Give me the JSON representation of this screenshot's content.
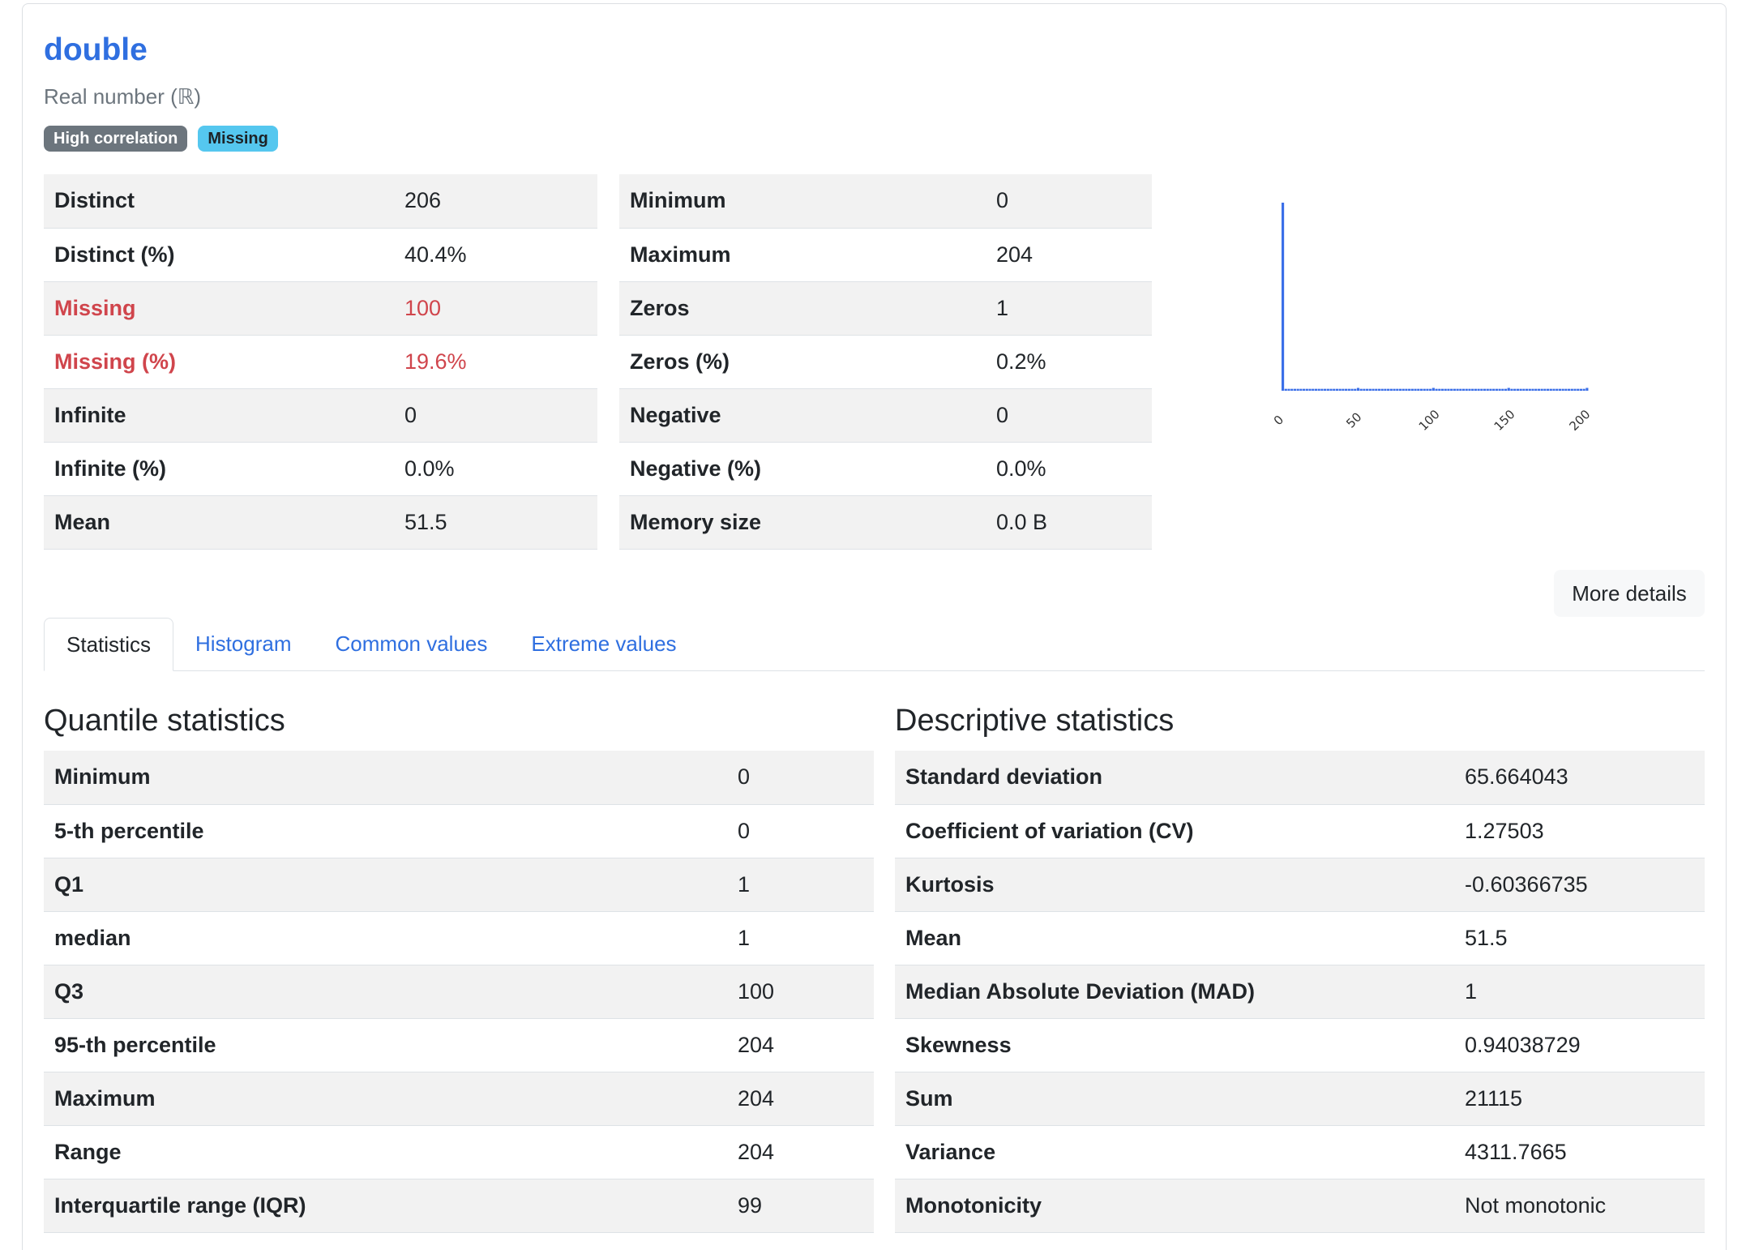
{
  "variable": {
    "name": "double",
    "type": "Real number (ℝ)",
    "badges": [
      "High correlation",
      "Missing"
    ]
  },
  "overview_left": [
    {
      "label": "Distinct",
      "value": "206",
      "alert": false
    },
    {
      "label": "Distinct (%)",
      "value": "40.4%",
      "alert": false
    },
    {
      "label": "Missing",
      "value": "100",
      "alert": true
    },
    {
      "label": "Missing (%)",
      "value": "19.6%",
      "alert": true
    },
    {
      "label": "Infinite",
      "value": "0",
      "alert": false
    },
    {
      "label": "Infinite (%)",
      "value": "0.0%",
      "alert": false
    },
    {
      "label": "Mean",
      "value": "51.5",
      "alert": false
    }
  ],
  "overview_right": [
    {
      "label": "Minimum",
      "value": "0"
    },
    {
      "label": "Maximum",
      "value": "204"
    },
    {
      "label": "Zeros",
      "value": "1"
    },
    {
      "label": "Zeros (%)",
      "value": "0.2%"
    },
    {
      "label": "Negative",
      "value": "0"
    },
    {
      "label": "Negative (%)",
      "value": "0.0%"
    },
    {
      "label": "Memory size",
      "value": "0.0 B"
    }
  ],
  "more_details_label": "More details",
  "tabs": [
    {
      "label": "Statistics",
      "active": true
    },
    {
      "label": "Histogram",
      "active": false
    },
    {
      "label": "Common values",
      "active": false
    },
    {
      "label": "Extreme values",
      "active": false
    }
  ],
  "quantile": {
    "title": "Quantile statistics",
    "rows": [
      {
        "label": "Minimum",
        "value": "0"
      },
      {
        "label": "5-th percentile",
        "value": "0"
      },
      {
        "label": "Q1",
        "value": "1"
      },
      {
        "label": "median",
        "value": "1"
      },
      {
        "label": "Q3",
        "value": "100"
      },
      {
        "label": "95-th percentile",
        "value": "204"
      },
      {
        "label": "Maximum",
        "value": "204"
      },
      {
        "label": "Range",
        "value": "204"
      },
      {
        "label": "Interquartile range (IQR)",
        "value": "99"
      }
    ]
  },
  "descriptive": {
    "title": "Descriptive statistics",
    "rows": [
      {
        "label": "Standard deviation",
        "value": "65.664043"
      },
      {
        "label": "Coefficient of variation (CV)",
        "value": "1.27503"
      },
      {
        "label": "Kurtosis",
        "value": "-0.60366735"
      },
      {
        "label": "Mean",
        "value": "51.5"
      },
      {
        "label": "Median Absolute Deviation (MAD)",
        "value": "1"
      },
      {
        "label": "Skewness",
        "value": "0.94038729"
      },
      {
        "label": "Sum",
        "value": "21115"
      },
      {
        "label": "Variance",
        "value": "4311.7665"
      },
      {
        "label": "Monotonicity",
        "value": "Not monotonic"
      }
    ]
  },
  "chart_data": {
    "type": "bar",
    "x": [
      0,
      2,
      4,
      6,
      8,
      10,
      12,
      14,
      16,
      18,
      20,
      22,
      24,
      26,
      28,
      30,
      32,
      34,
      36,
      38,
      40,
      42,
      44,
      46,
      48,
      50,
      52,
      54,
      56,
      58,
      60,
      62,
      64,
      66,
      68,
      70,
      72,
      74,
      76,
      78,
      80,
      82,
      84,
      86,
      88,
      90,
      92,
      94,
      96,
      98,
      100,
      102,
      104,
      106,
      108,
      110,
      112,
      114,
      116,
      118,
      120,
      122,
      124,
      126,
      128,
      130,
      132,
      134,
      136,
      138,
      140,
      142,
      144,
      146,
      148,
      150,
      152,
      154,
      156,
      158,
      160,
      162,
      164,
      166,
      168,
      170,
      172,
      174,
      176,
      178,
      180,
      182,
      184,
      186,
      188,
      190,
      192,
      194,
      196,
      198,
      200,
      202
    ],
    "values": [
      200,
      2,
      2,
      2,
      2,
      2,
      2,
      2,
      2,
      2,
      2,
      2,
      2,
      2,
      2,
      2,
      2,
      2,
      2,
      2,
      2,
      2,
      2,
      2,
      2,
      3,
      2,
      2,
      2,
      2,
      2,
      2,
      2,
      2,
      2,
      2,
      2,
      2,
      2,
      2,
      2,
      2,
      2,
      2,
      2,
      2,
      2,
      2,
      2,
      2,
      3,
      2,
      2,
      2,
      2,
      2,
      2,
      2,
      2,
      2,
      2,
      2,
      2,
      2,
      2,
      2,
      2,
      2,
      2,
      2,
      2,
      2,
      2,
      2,
      2,
      3,
      2,
      2,
      2,
      2,
      2,
      2,
      2,
      2,
      2,
      2,
      2,
      2,
      2,
      2,
      2,
      2,
      2,
      2,
      2,
      2,
      2,
      2,
      2,
      2,
      2,
      3
    ],
    "xticks": [
      "0",
      "50",
      "100",
      "150",
      "200"
    ],
    "xtick_values": [
      0,
      50,
      100,
      150,
      200
    ],
    "xlim": [
      0,
      204
    ],
    "ylim": [
      0,
      200
    ],
    "grid": false,
    "bar_color": "#3b6fe8"
  },
  "colors": {
    "link": "#2f6fe0",
    "alert": "#d0454c",
    "badge_gray": "#6c757d",
    "badge_cyan": "#55c7ef"
  }
}
